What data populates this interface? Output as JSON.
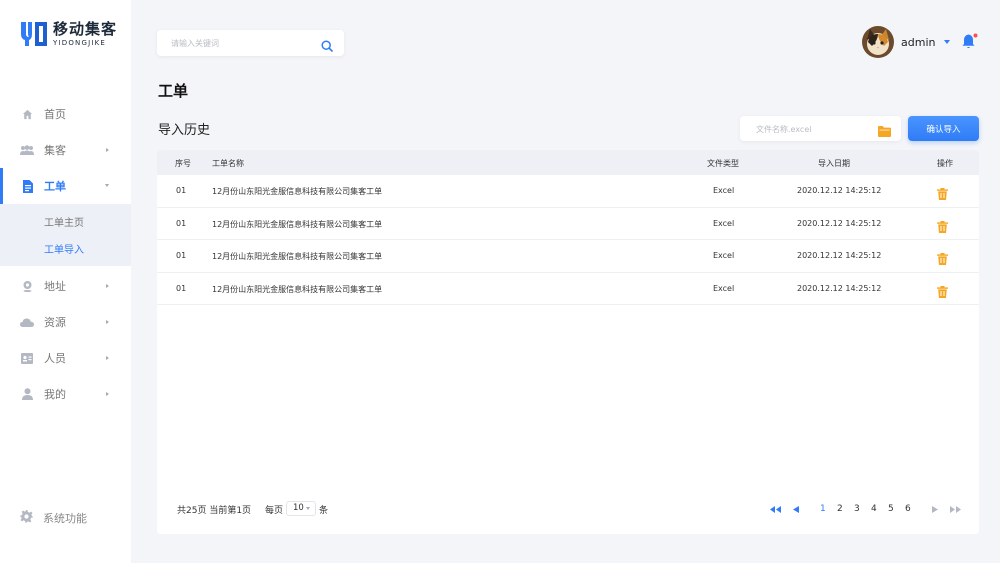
{
  "app": {
    "logo_title": "移动集客",
    "logo_subtitle": "YIDONGJIKE"
  },
  "sidebar": {
    "items": [
      {
        "label": "首页",
        "icon": "home-icon"
      },
      {
        "label": "集客",
        "icon": "group-icon"
      },
      {
        "label": "工单",
        "icon": "document-icon"
      },
      {
        "label": "地址",
        "icon": "location-icon"
      },
      {
        "label": "资源",
        "icon": "cloud-icon"
      },
      {
        "label": "人员",
        "icon": "id-card-icon"
      },
      {
        "label": "我的",
        "icon": "user-icon"
      }
    ],
    "sub_items": [
      {
        "label": "工单主页"
      },
      {
        "label": "工单导入"
      }
    ],
    "system": {
      "label": "系统功能",
      "icon": "gear-icon"
    }
  },
  "search": {
    "placeholder": "请输入关键词"
  },
  "user": {
    "name": "admin"
  },
  "page": {
    "title": "工单",
    "section_title": "导入历史"
  },
  "import": {
    "file_placeholder": "文件名称.excel",
    "confirm_label": "确认导入"
  },
  "table": {
    "headers": {
      "no": "序号",
      "name": "工单名称",
      "type": "文件类型",
      "date": "导入日期",
      "op": "操作"
    },
    "rows": [
      {
        "no": "01",
        "name": "12月份山东阳光金服信息科技有限公司集客工单",
        "type": "Excel",
        "date": "2020.12.12  14:25:12"
      },
      {
        "no": "01",
        "name": "12月份山东阳光金服信息科技有限公司集客工单",
        "type": "Excel",
        "date": "2020.12.12  14:25:12"
      },
      {
        "no": "01",
        "name": "12月份山东阳光金服信息科技有限公司集客工单",
        "type": "Excel",
        "date": "2020.12.12  14:25:12"
      },
      {
        "no": "01",
        "name": "12月份山东阳光金服信息科技有限公司集客工单",
        "type": "Excel",
        "date": "2020.12.12  14:25:12"
      }
    ]
  },
  "pagination": {
    "total_text": "共25页  当前第1页",
    "per_page_label": "每页",
    "per_page_value": "10",
    "unit": "条",
    "pages": [
      "1",
      "2",
      "3",
      "4",
      "5",
      "6"
    ],
    "current": "1"
  },
  "colors": {
    "accent": "#2f7cf6",
    "delete": "#f5a623",
    "notification": "#ff4d4f"
  }
}
